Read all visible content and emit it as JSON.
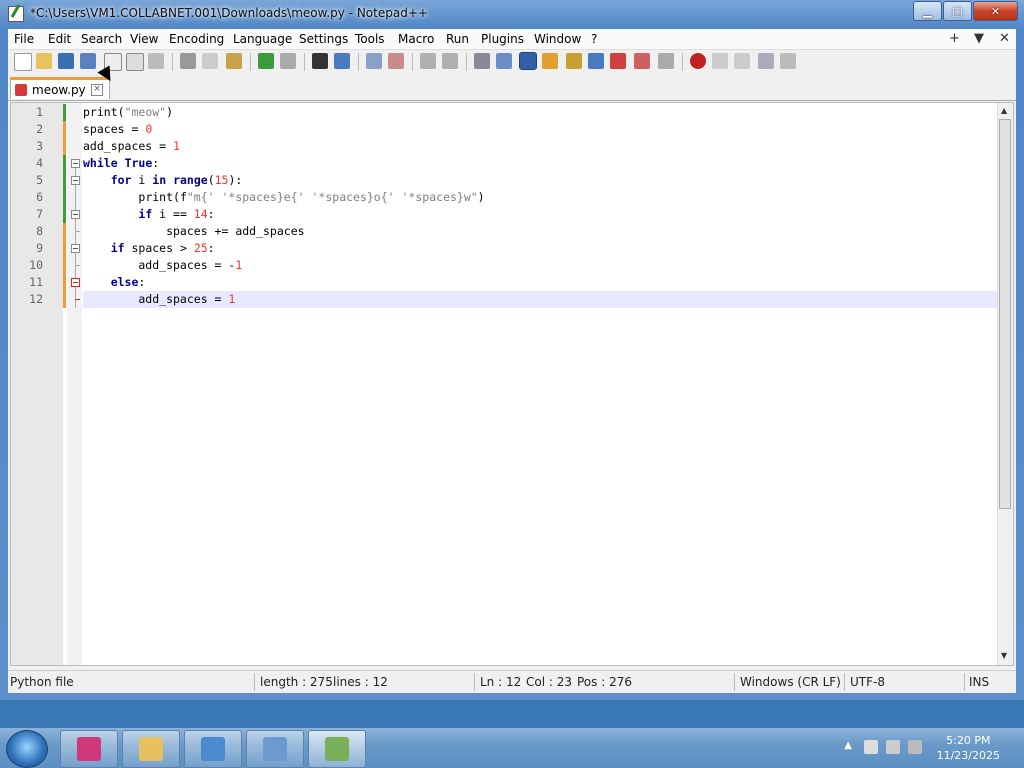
{
  "window": {
    "title": "*C:\\Users\\VM1.COLLABNET.001\\Downloads\\meow.py - Notepad++",
    "minimize_label": "▁",
    "maximize_label": "□",
    "close_label": "✕"
  },
  "menu": {
    "items": [
      "File",
      "Edit",
      "Search",
      "View",
      "Encoding",
      "Language",
      "Settings",
      "Tools",
      "Macro",
      "Run",
      "Plugins",
      "Window",
      "?"
    ],
    "right": [
      "+",
      "▼",
      "✕"
    ]
  },
  "tab": {
    "name": "meow.py",
    "close": "×"
  },
  "editor": {
    "line_numbers": [
      "1",
      "2",
      "3",
      "4",
      "5",
      "6",
      "7",
      "8",
      "9",
      "10",
      "11",
      "12"
    ],
    "current_line": 12
  },
  "status": {
    "lang": "Python file",
    "length": "length : 275",
    "lines": "lines : 12",
    "ln": "Ln : 12",
    "col": "Col : 23",
    "pos": "Pos : 276",
    "eol": "Windows (CR LF)",
    "encoding": "UTF-8",
    "mode": "INS"
  },
  "taskbar": {
    "time": "5:20 PM",
    "date": "11/23/2025"
  },
  "colors": {
    "accent": "#f29b36",
    "keyword": "#00008b",
    "number": "#ff3030",
    "string": "#808080"
  }
}
